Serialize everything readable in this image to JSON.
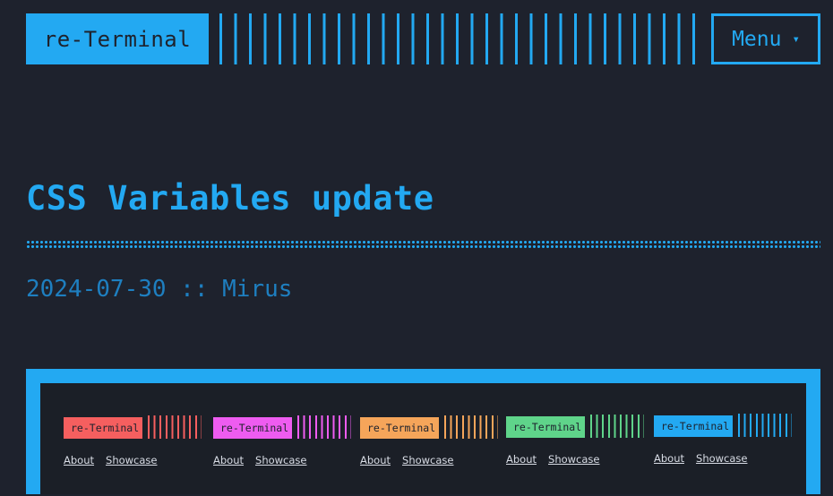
{
  "header": {
    "logo": "re-Terminal",
    "menu_label": "Menu",
    "menu_arrow": "▾",
    "accent": "#23a9f2"
  },
  "post": {
    "title": "CSS Variables update",
    "meta": "2024-07-30 :: Mirus"
  },
  "figure": {
    "variants": [
      {
        "logo": "re-Terminal",
        "color": "#f55f5f",
        "links": [
          "About",
          "Showcase"
        ]
      },
      {
        "logo": "re-Terminal",
        "color": "#ee5cf0",
        "links": [
          "About",
          "Showcase"
        ]
      },
      {
        "logo": "re-Terminal",
        "color": "#f5a55a",
        "links": [
          "About",
          "Showcase"
        ]
      },
      {
        "logo": "re-Terminal",
        "color": "#5fd48a",
        "links": [
          "About",
          "Showcase"
        ]
      },
      {
        "logo": "re-Terminal",
        "color": "#23a9f2",
        "links": [
          "About",
          "Showcase"
        ]
      }
    ]
  }
}
